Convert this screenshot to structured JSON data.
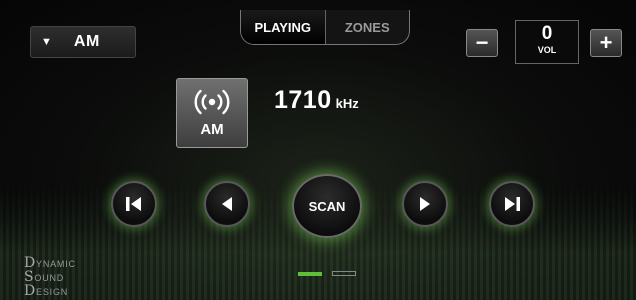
{
  "source": {
    "label": "AM",
    "arrow_icon": "triangle-down-icon"
  },
  "tabs": [
    {
      "label": "PLAYING",
      "active": true
    },
    {
      "label": "ZONES",
      "active": false
    }
  ],
  "volume": {
    "value": "0",
    "label": "VOL",
    "minus": "−",
    "plus": "+"
  },
  "station": {
    "band": "AM",
    "frequency": "1710",
    "unit": "kHz",
    "icon": "radio-broadcast-icon"
  },
  "transport": {
    "scan_label": "SCAN"
  },
  "logo": {
    "line1_initial": "D",
    "line1_rest": "YNAMIC",
    "line2_initial": "S",
    "line2_rest": "OUND",
    "line3_initial": "D",
    "line3_rest": "ESIGN"
  },
  "pager": {
    "pages": 2,
    "current": 1
  },
  "colors": {
    "accent_glow": "#5fbf3a",
    "background": "#0b0c0b"
  }
}
